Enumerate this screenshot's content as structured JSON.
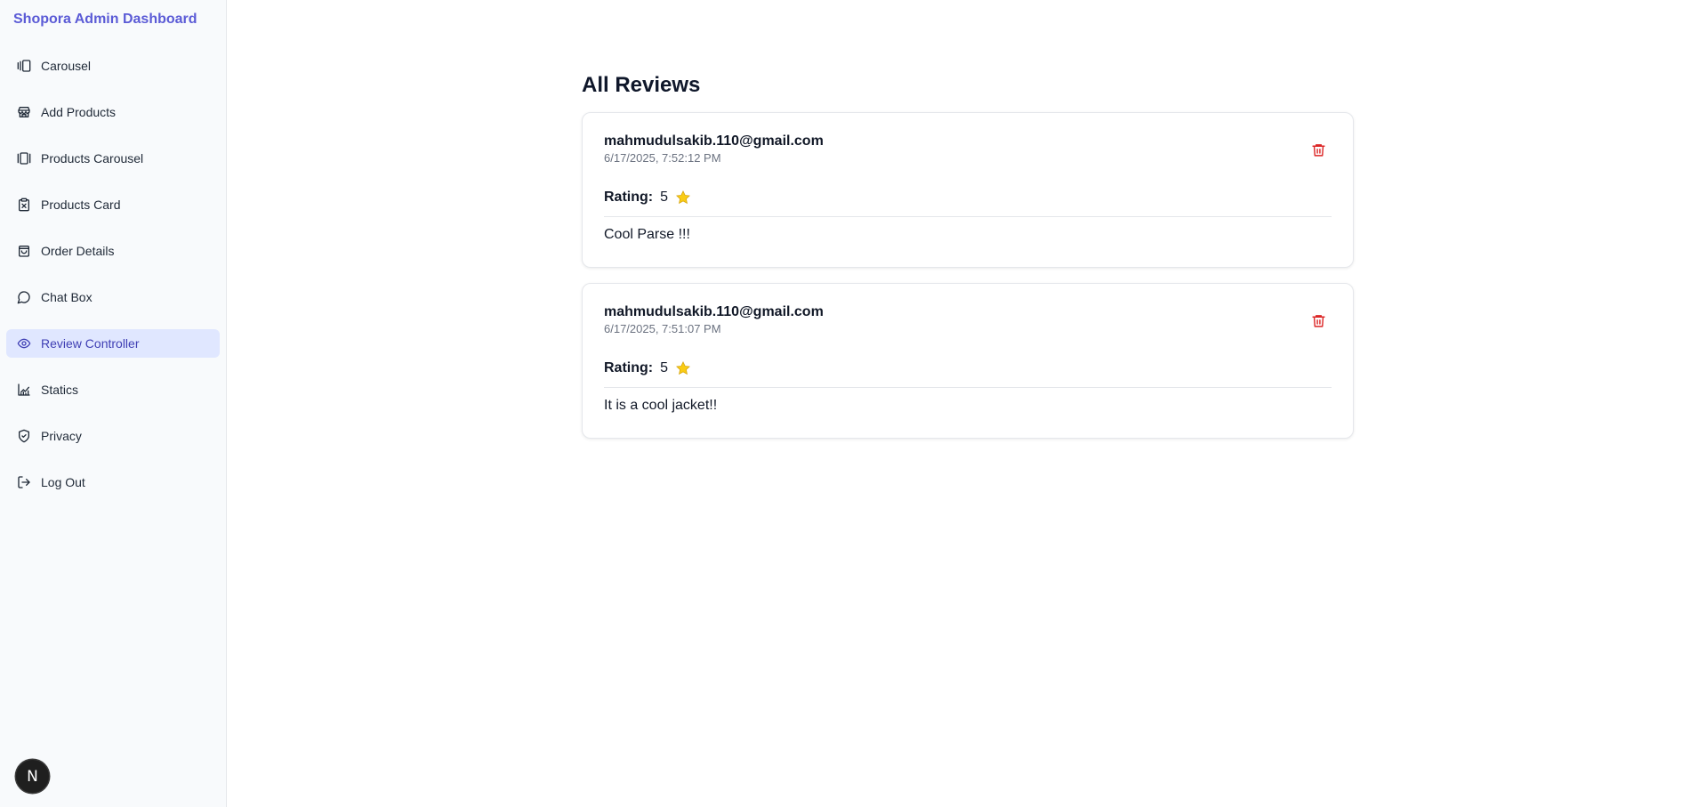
{
  "brand": "Shopora Admin Dashboard",
  "nav": [
    {
      "label": "Carousel",
      "icon": "gallery-icon"
    },
    {
      "label": "Add Products",
      "icon": "store-icon"
    },
    {
      "label": "Products Carousel",
      "icon": "gallery-thumbnails-icon"
    },
    {
      "label": "Products Card",
      "icon": "clipboard-x-icon"
    },
    {
      "label": "Order Details",
      "icon": "shopping-bag-icon"
    },
    {
      "label": "Chat Box",
      "icon": "message-circle-icon"
    },
    {
      "label": "Review Controller",
      "icon": "eye-icon",
      "active": true
    },
    {
      "label": "Statics",
      "icon": "chart-line-icon"
    },
    {
      "label": "Privacy",
      "icon": "shield-check-icon"
    },
    {
      "label": "Log Out",
      "icon": "log-out-icon"
    }
  ],
  "main": {
    "title": "All Reviews",
    "reviews": [
      {
        "email": "mahmudulsakib.110@gmail.com",
        "date": "6/17/2025, 7:52:12 PM",
        "rating_label": "Rating:",
        "rating": "5",
        "text": "Cool Parse !!!"
      },
      {
        "email": "mahmudulsakib.110@gmail.com",
        "date": "6/17/2025, 7:51:07 PM",
        "rating_label": "Rating:",
        "rating": "5",
        "text": "It is a cool jacket!!"
      }
    ]
  },
  "dev_badge": "N",
  "colors": {
    "brand": "#5b5bd6",
    "active_bg": "#e0e7ff",
    "active_text": "#3f3fb4",
    "delete": "#dc2626",
    "star": "#facc15"
  }
}
